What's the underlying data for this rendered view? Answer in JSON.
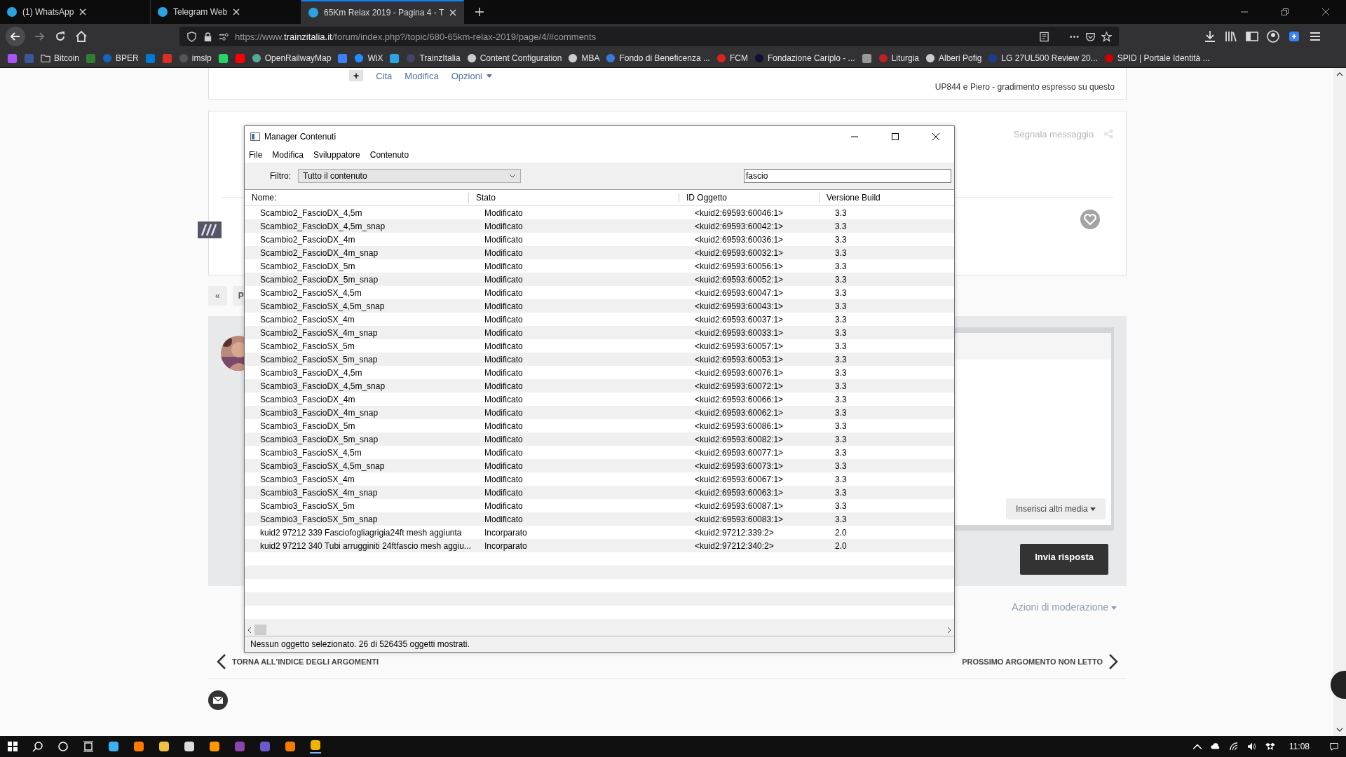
{
  "browser": {
    "tabs": [
      {
        "title": "(1) WhatsApp",
        "selected": false
      },
      {
        "title": "Telegram Web",
        "selected": false
      },
      {
        "title": "65Km Relax 2019 - Pagina 4 - T",
        "selected": true
      }
    ],
    "address": {
      "scheme": "https://www.",
      "domain": "trainzitalia.it",
      "path": "/forum/index.php?/topic/680-65km-relax-2019/page/4/#comments"
    },
    "bookmarks": [
      {
        "kind": "icon"
      },
      {
        "kind": "icon"
      },
      {
        "kind": "folder",
        "label": "Bitcoin"
      },
      {
        "kind": "icon"
      },
      {
        "kind": "link",
        "label": "BPER"
      },
      {
        "kind": "icon"
      },
      {
        "kind": "icon"
      },
      {
        "kind": "link",
        "label": "imslp"
      },
      {
        "kind": "icon"
      },
      {
        "kind": "icon"
      },
      {
        "kind": "link",
        "label": "OpenRailwayMap"
      },
      {
        "kind": "icon"
      },
      {
        "kind": "link",
        "label": "WiX"
      },
      {
        "kind": "icon"
      },
      {
        "kind": "link",
        "label": "TrainzItalia"
      },
      {
        "kind": "link",
        "label": "Content Configuration"
      },
      {
        "kind": "link",
        "label": "MBA"
      },
      {
        "kind": "link",
        "label": "Fondo di Beneficenza ..."
      },
      {
        "kind": "link",
        "label": "FCM"
      },
      {
        "kind": "link",
        "label": "Fondazione Cariplo - ..."
      },
      {
        "kind": "icon"
      },
      {
        "kind": "link",
        "label": "Liturgia"
      },
      {
        "kind": "link",
        "label": "Alberi Pofig"
      },
      {
        "kind": "link",
        "label": "LG 27UL500 Review 20..."
      },
      {
        "kind": "link",
        "label": "SPID | Portale Identità ..."
      }
    ]
  },
  "page": {
    "post_actions": [
      "Cita",
      "Modifica",
      "Opzioni"
    ],
    "add_symbol": "+",
    "likes_text": "UP844 e Piero - gradimento espresso su questo",
    "report_link": "Segnala messaggio",
    "pager": {
      "first": "«",
      "prev": "P"
    },
    "media_button": "Inserisci altri media",
    "send_button": "Invia risposta",
    "moderation": "Azioni di moderazione",
    "back_link": "TORNA ALL'INDICE DEGLI ARGOMENTI",
    "next_link": "PROSSIMO ARGOMENTO NON LETTO"
  },
  "dialog": {
    "title": "Manager Contenuti",
    "menu": [
      "File",
      "Modifica",
      "Sviluppatore",
      "Contenuto"
    ],
    "filter_label": "Filtro:",
    "filter_value": "Tutto il contenuto",
    "search_value": "fascio",
    "columns": [
      "Nome:",
      "Stato",
      "ID Oggetto",
      "Versione Build"
    ],
    "rows": [
      {
        "name": "Scambio2_FascioDX_4,5m",
        "state": "Modificato",
        "id": "<kuid2:69593:60046:1>",
        "build": "3.3"
      },
      {
        "name": "Scambio2_FascioDX_4,5m_snap",
        "state": "Modificato",
        "id": "<kuid2:69593:60042:1>",
        "build": "3.3"
      },
      {
        "name": "Scambio2_FascioDX_4m",
        "state": "Modificato",
        "id": "<kuid2:69593:60036:1>",
        "build": "3.3"
      },
      {
        "name": "Scambio2_FascioDX_4m_snap",
        "state": "Modificato",
        "id": "<kuid2:69593:60032:1>",
        "build": "3.3"
      },
      {
        "name": "Scambio2_FascioDX_5m",
        "state": "Modificato",
        "id": "<kuid2:69593:60056:1>",
        "build": "3.3"
      },
      {
        "name": "Scambio2_FascioDX_5m_snap",
        "state": "Modificato",
        "id": "<kuid2:69593:60052:1>",
        "build": "3.3"
      },
      {
        "name": "Scambio2_FascioSX_4,5m",
        "state": "Modificato",
        "id": "<kuid2:69593:60047:1>",
        "build": "3.3"
      },
      {
        "name": "Scambio2_FascioSX_4,5m_snap",
        "state": "Modificato",
        "id": "<kuid2:69593:60043:1>",
        "build": "3.3"
      },
      {
        "name": "Scambio2_FascioSX_4m",
        "state": "Modificato",
        "id": "<kuid2:69593:60037:1>",
        "build": "3.3"
      },
      {
        "name": "Scambio2_FascioSX_4m_snap",
        "state": "Modificato",
        "id": "<kuid2:69593:60033:1>",
        "build": "3.3"
      },
      {
        "name": "Scambio2_FascioSX_5m",
        "state": "Modificato",
        "id": "<kuid2:69593:60057:1>",
        "build": "3.3"
      },
      {
        "name": "Scambio2_FascioSX_5m_snap",
        "state": "Modificato",
        "id": "<kuid2:69593:60053:1>",
        "build": "3.3"
      },
      {
        "name": "Scambio3_FascioDX_4,5m",
        "state": "Modificato",
        "id": "<kuid2:69593:60076:1>",
        "build": "3.3"
      },
      {
        "name": "Scambio3_FascioDX_4,5m_snap",
        "state": "Modificato",
        "id": "<kuid2:69593:60072:1>",
        "build": "3.3"
      },
      {
        "name": "Scambio3_FascioDX_4m",
        "state": "Modificato",
        "id": "<kuid2:69593:60066:1>",
        "build": "3.3"
      },
      {
        "name": "Scambio3_FascioDX_4m_snap",
        "state": "Modificato",
        "id": "<kuid2:69593:60062:1>",
        "build": "3.3"
      },
      {
        "name": "Scambio3_FascioDX_5m",
        "state": "Modificato",
        "id": "<kuid2:69593:60086:1>",
        "build": "3.3"
      },
      {
        "name": "Scambio3_FascioDX_5m_snap",
        "state": "Modificato",
        "id": "<kuid2:69593:60082:1>",
        "build": "3.3"
      },
      {
        "name": "Scambio3_FascioSX_4,5m",
        "state": "Modificato",
        "id": "<kuid2:69593:60077:1>",
        "build": "3.3"
      },
      {
        "name": "Scambio3_FascioSX_4,5m_snap",
        "state": "Modificato",
        "id": "<kuid2:69593:60073:1>",
        "build": "3.3"
      },
      {
        "name": "Scambio3_FascioSX_4m",
        "state": "Modificato",
        "id": "<kuid2:69593:60067:1>",
        "build": "3.3"
      },
      {
        "name": "Scambio3_FascioSX_4m_snap",
        "state": "Modificato",
        "id": "<kuid2:69593:60063:1>",
        "build": "3.3"
      },
      {
        "name": "Scambio3_FascioSX_5m",
        "state": "Modificato",
        "id": "<kuid2:69593:60087:1>",
        "build": "3.3"
      },
      {
        "name": "Scambio3_FascioSX_5m_snap",
        "state": "Modificato",
        "id": "<kuid2:69593:60083:1>",
        "build": "3.3"
      },
      {
        "name": "kuid2 97212 339 Fasciofogliagrigia24ft mesh aggiunta",
        "state": "Incorparato",
        "id": "<kuid2:97212:339:2>",
        "build": "2.0"
      },
      {
        "name": "kuid2 97212 340 Tubi arrugginiti 24ftfascio mesh aggiu...",
        "state": "Incorparato",
        "id": "<kuid2:97212:340:2>",
        "build": "2.0"
      }
    ],
    "status": "Nessun oggetto selezionato. 26 di 526435 oggetti mostrati."
  },
  "taskbar": {
    "time": "11:08"
  }
}
